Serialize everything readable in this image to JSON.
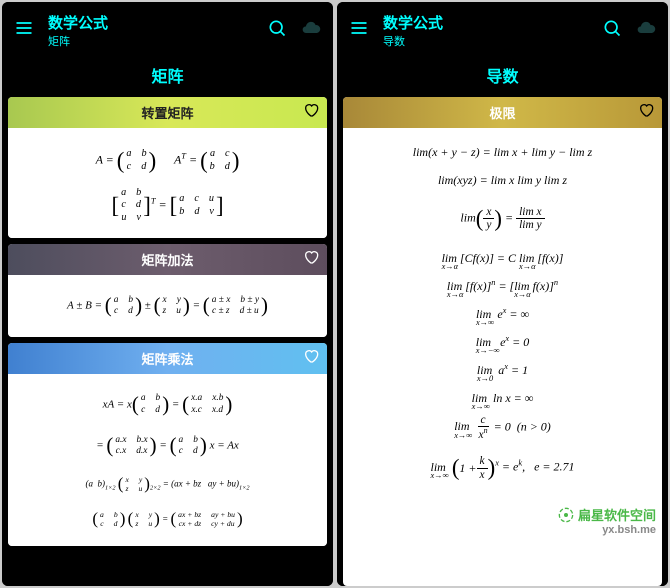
{
  "left": {
    "app_title": "数学公式",
    "subtitle": "矩阵",
    "page_header": "矩阵",
    "sections": [
      {
        "title": "转置矩阵"
      },
      {
        "title": "矩阵加法"
      },
      {
        "title": "矩阵乘法"
      }
    ]
  },
  "right": {
    "app_title": "数学公式",
    "subtitle": "导数",
    "page_header": "导数",
    "sections": [
      {
        "title": "极限"
      }
    ],
    "formulas": [
      "lim(x + y − z) = lim x + lim y − lim z",
      "lim(xyz) = lim x lim y lim z",
      "lim (x/y) = lim x / lim y",
      "lim_{x→α}[Cf(x)] = C lim_{x→α}[f(x)]",
      "lim_{x→α}[f(x)]^n = [lim_{x→α} f(x)]^n",
      "lim_{x→∞} e^x = ∞",
      "lim_{x→−∞} e^x = 0",
      "lim_{x→0} a^x = 1",
      "lim_{x→∞} ln x = ∞",
      "lim_{x→∞} c/x^n = 0  (n > 0)",
      "lim_{x→∞} (1 + k/x)^x = e^k,  e ≈ 2.71"
    ]
  },
  "watermark": {
    "text": "扁星软件空间",
    "url": "yx.bsh.me"
  },
  "chart_data": {
    "type": "table",
    "note": "Screenshots show math-formula reference app. Left pane: matrix operations (transpose, addition, multiplication). Right pane: limit identities."
  }
}
